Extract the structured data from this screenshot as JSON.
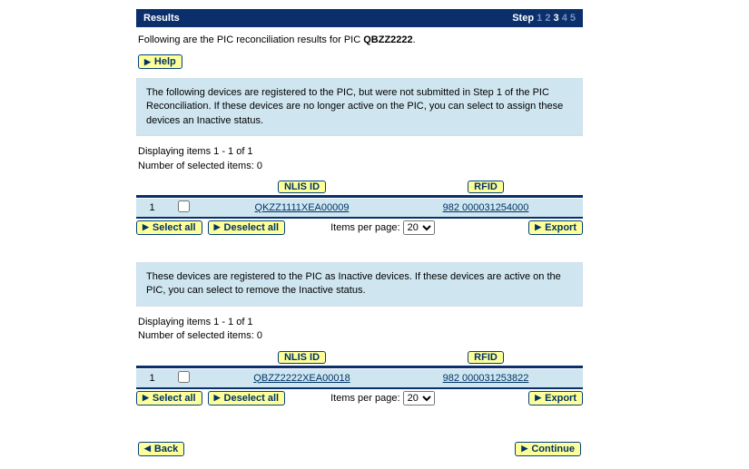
{
  "header": {
    "title": "Results",
    "step_label": "Step",
    "steps": [
      "1",
      "2",
      "3",
      "4",
      "5"
    ],
    "current_step_index": 2
  },
  "intro": {
    "prefix": "Following are the PIC reconciliation results for PIC ",
    "pic": "QBZZ2222",
    "suffix": "."
  },
  "buttons": {
    "help": "Help",
    "select_all": "Select all",
    "deselect_all": "Deselect all",
    "export": "Export",
    "back": "Back",
    "continue": "Continue"
  },
  "labels": {
    "items_per_page": "Items per page:",
    "nlis_id": "NLIS ID",
    "rfid": "RFID"
  },
  "items_per_page_value": "20",
  "section1": {
    "info": "The following devices are registered to the PIC, but were not submitted in Step 1 of the PIC Reconciliation. If these devices are no longer active on the PIC, you can select to assign these devices an Inactive status.",
    "displaying_line": "Displaying items 1 - 1 of 1",
    "selected_line": "Number of selected items: 0",
    "rows": [
      {
        "idx": "1",
        "nlis": "QKZZ1111XEA00009",
        "rfid": "982 000031254000"
      }
    ]
  },
  "section2": {
    "info": "These devices are registered to the PIC as Inactive devices. If these devices are active on the PIC, you can select to remove the Inactive status.",
    "displaying_line": "Displaying items 1 - 1 of 1",
    "selected_line": "Number of selected items: 0",
    "rows": [
      {
        "idx": "1",
        "nlis": "QBZZ2222XEA00018",
        "rfid": "982 000031253822"
      }
    ]
  }
}
